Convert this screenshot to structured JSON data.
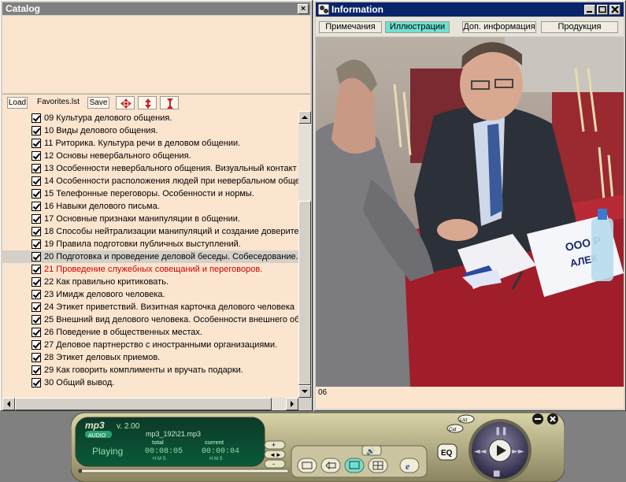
{
  "catalog": {
    "title": "Catalog",
    "close_label": "×",
    "toolbar": {
      "load": "Load",
      "file": "Favorites.lst",
      "save": "Save"
    },
    "items": [
      {
        "text": "09 Культура делового общения.",
        "checked": true,
        "selected": false,
        "red": false
      },
      {
        "text": "10 Виды делового общения.",
        "checked": true,
        "selected": false,
        "red": false
      },
      {
        "text": "11 Риторика. Культура речи в деловом общении.",
        "checked": true,
        "selected": false,
        "red": false
      },
      {
        "text": "12 Основы невербального общения.",
        "checked": true,
        "selected": false,
        "red": false
      },
      {
        "text": "13 Особенности невербального общения. Визуальный контакт",
        "checked": true,
        "selected": false,
        "red": false
      },
      {
        "text": "14 Особенности расположения людей при невербальном обще",
        "checked": true,
        "selected": false,
        "red": false
      },
      {
        "text": "15 Телефонные переговоры. Особенности и нормы.",
        "checked": true,
        "selected": false,
        "red": false
      },
      {
        "text": "16 Навыки делового письма.",
        "checked": true,
        "selected": false,
        "red": false
      },
      {
        "text": "17 Основные признаки манипуляции в общении.",
        "checked": true,
        "selected": false,
        "red": false
      },
      {
        "text": "18 Способы нейтрализации манипуляций и создание доверите",
        "checked": true,
        "selected": false,
        "red": false
      },
      {
        "text": "19 Правила подготовки публичных выступлений.",
        "checked": true,
        "selected": false,
        "red": false
      },
      {
        "text": "20 Подготовка и проведение деловой беседы. Собеседование.",
        "checked": true,
        "selected": true,
        "red": false
      },
      {
        "text": "21 Проведение служебных совещаний и переговоров.",
        "checked": true,
        "selected": false,
        "red": true
      },
      {
        "text": "22 Как правильно критиковать.",
        "checked": true,
        "selected": false,
        "red": false
      },
      {
        "text": "23 Имидж делового человека.",
        "checked": true,
        "selected": false,
        "red": false
      },
      {
        "text": "24 Этикет приветствий. Визитная карточка делового человека",
        "checked": true,
        "selected": false,
        "red": false
      },
      {
        "text": "25 Внешний вид делового человека. Особенности внешнего об",
        "checked": true,
        "selected": false,
        "red": false
      },
      {
        "text": "26 Поведение в общественных местах.",
        "checked": true,
        "selected": false,
        "red": false
      },
      {
        "text": "27 Деловое партнерство с иностранными организациями.",
        "checked": true,
        "selected": false,
        "red": false
      },
      {
        "text": "28 Этикет деловых приемов.",
        "checked": true,
        "selected": false,
        "red": false
      },
      {
        "text": "29 Как говорить комплименты и вручать подарки.",
        "checked": true,
        "selected": false,
        "red": false
      },
      {
        "text": "30 Общий вывод.",
        "checked": true,
        "selected": false,
        "red": false
      }
    ]
  },
  "info": {
    "title": "Information",
    "tabs": [
      "Примечания",
      "Иллюстрации",
      "Доп. информация",
      "Продукция"
    ],
    "active_tab": 1,
    "status": "06",
    "sign_text_1": "ООО Р",
    "sign_text_2": "АЛЕК"
  },
  "player": {
    "logo": "mp3",
    "version": "v. 2.00",
    "audio_label": "AUDIO",
    "track": "mp3_192\\21.mp3",
    "state": "Playing",
    "total_label": "total",
    "current_label": "current",
    "total_time": "00:08:05",
    "current_time": "00:00:04",
    "hms": "H M S",
    "eq_label": "EQ",
    "list_label": "List",
    "cat_label": "Cat"
  },
  "colors": {
    "panel": "#fbe5cf",
    "title_active": "#0a246a",
    "title_inactive": "#808080",
    "tab_active": "#6fe0d0",
    "red_item": "#cc0000",
    "player_body": "#a9a27a"
  }
}
